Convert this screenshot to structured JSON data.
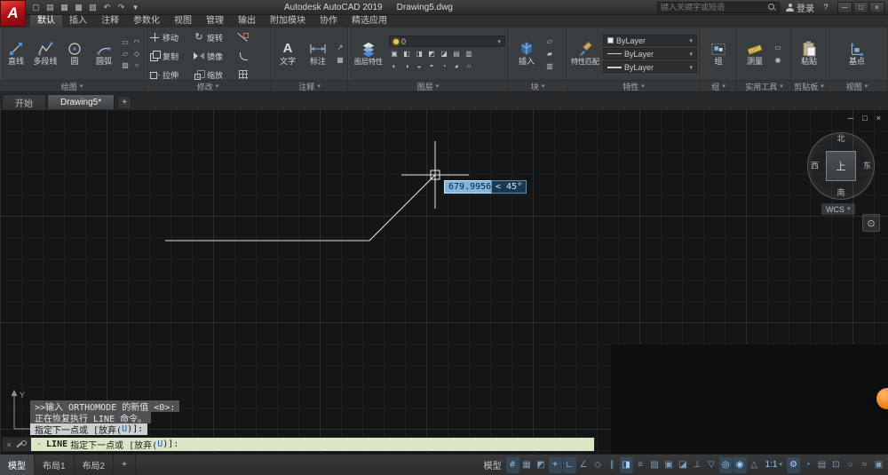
{
  "icons": {
    "chevron_down": "▾",
    "close": "×",
    "minimize": "─",
    "maximize": "□",
    "help": "?",
    "rotate": "↻",
    "text_tool": "A",
    "wheel": "⊙",
    "dash": "-"
  },
  "titlebar": {
    "logo_letter": "A",
    "quick_access": [
      {
        "name": "new-file",
        "glyph": "▢"
      },
      {
        "name": "open-file",
        "glyph": "▤"
      },
      {
        "name": "save-file",
        "glyph": "▦"
      },
      {
        "name": "save-as",
        "glyph": "▩"
      },
      {
        "name": "plot",
        "glyph": "▧"
      },
      {
        "name": "undo",
        "glyph": "↶"
      },
      {
        "name": "redo",
        "glyph": "↷"
      },
      {
        "name": "qat-menu",
        "glyph": "▾"
      }
    ],
    "app_title": "Autodesk AutoCAD 2019",
    "doc_title": "Drawing5.dwg",
    "search_placeholder": "键入关键字或短语",
    "sign_in": "登录"
  },
  "ribbon_tabs": [
    {
      "label": "默认",
      "active": true
    },
    {
      "label": "插入"
    },
    {
      "label": "注释"
    },
    {
      "label": "参数化"
    },
    {
      "label": "视图"
    },
    {
      "label": "管理"
    },
    {
      "label": "输出"
    },
    {
      "label": "附加模块"
    },
    {
      "label": "协作"
    },
    {
      "label": "精选应用"
    }
  ],
  "panels": {
    "draw": {
      "label": "绘图",
      "tools": [
        "直线",
        "多段线",
        "圆",
        "圆弧"
      ],
      "minis": [
        "▭",
        "◠",
        "▱",
        "◇",
        "▨",
        "○"
      ]
    },
    "modify": {
      "label": "修改",
      "tools": [
        "移动",
        "旋转",
        "复制",
        "镜像",
        "拉伸",
        "缩放"
      ]
    },
    "annotate": {
      "label": "注释",
      "text": "文字",
      "dim": "标注",
      "minis": [
        "↗",
        "▦"
      ]
    },
    "layers": {
      "label": "图层",
      "properties": "图层特性",
      "current": "0",
      "minis1": [
        "▣",
        "◧",
        "◨",
        "◩",
        "◪",
        "▤",
        "▥"
      ],
      "minis2": [
        "◐",
        "◑",
        "◒",
        "◓",
        "◔",
        "◕",
        "○"
      ]
    },
    "block": {
      "label": "块",
      "insert": "插入",
      "minis": [
        "▱",
        "▰",
        "▥"
      ]
    },
    "props": {
      "label": "特性",
      "match": "特性匹配",
      "color": "ByLayer",
      "linetype": "ByLayer",
      "lineweight": "ByLayer"
    },
    "groups": {
      "label": "组",
      "group": "组"
    },
    "utils": {
      "label": "实用工具",
      "measure": "测量",
      "minis": [
        "▭",
        "◉"
      ]
    },
    "clipboard": {
      "label": "剪贴板",
      "paste": "粘贴"
    },
    "view": {
      "label": "视图",
      "base": "基点"
    }
  },
  "file_tabs": [
    {
      "label": "开始",
      "name": "start"
    },
    {
      "label": "Drawing5*",
      "name": "drawing5",
      "active": true
    },
    {
      "label": "+",
      "name": "new-drawing"
    }
  ],
  "viewcube": {
    "north": "北",
    "south": "南",
    "east": "东",
    "west": "西",
    "top": "上",
    "wcs": "WCS"
  },
  "canvas": {
    "dyn_length": "679.9956",
    "dyn_angle": "< 45°"
  },
  "command": {
    "history": [
      ">>输入 ORTHOMODE 的新值 <0>:",
      "正在恢复执行 LINE 命令。"
    ],
    "h3_pre": "指定下一点或 [放弃(",
    "h3_link": "U",
    "h3_post": ")]:",
    "cmd": "LINE",
    "p_pre": "指定下一点或 [放弃(",
    "p_link": "U",
    "p_post": ")]:"
  },
  "layout_tabs": [
    {
      "label": "模型",
      "name": "model",
      "active": true
    },
    {
      "label": "布局1",
      "name": "layout1"
    },
    {
      "label": "布局2",
      "name": "layout2"
    },
    {
      "label": "+",
      "name": "new-layout"
    }
  ],
  "statusbar": {
    "model_label": "模型",
    "scale_label": "1:1",
    "icons": [
      {
        "name": "grid",
        "glyph": "#",
        "on": true
      },
      {
        "name": "snap",
        "glyph": "▦",
        "on": false
      },
      {
        "name": "infer-constraints",
        "glyph": "◩",
        "on": false
      },
      {
        "name": "dynamic-input",
        "glyph": "+",
        "on": true
      },
      {
        "name": "ortho",
        "glyph": "∟",
        "on": true
      },
      {
        "name": "polar-tracking",
        "glyph": "∠",
        "on": false
      },
      {
        "name": "isodraft",
        "glyph": "◇",
        "on": false
      },
      {
        "name": "osnap-tracking",
        "glyph": "∥",
        "on": false
      },
      {
        "name": "osnap",
        "glyph": "◨",
        "on": true
      },
      {
        "name": "lineweight",
        "glyph": "≡",
        "on": false
      },
      {
        "name": "transparency",
        "glyph": "▨",
        "on": false
      },
      {
        "name": "selection-cycling",
        "glyph": "▣",
        "on": false
      },
      {
        "name": "3d-osnap",
        "glyph": "◪",
        "on": false
      },
      {
        "name": "dynamic-ucs",
        "glyph": "⊥",
        "on": false
      },
      {
        "name": "selection-filter",
        "glyph": "▽",
        "on": false
      },
      {
        "name": "gizmo",
        "glyph": "◎",
        "on": true
      },
      {
        "name": "annotation-visibility",
        "glyph": "◉",
        "on": true
      },
      {
        "name": "autoscale",
        "glyph": "△",
        "on": false
      }
    ],
    "icons2": [
      {
        "name": "workspace",
        "glyph": "⚙",
        "on": true
      },
      {
        "name": "annotation-monitor",
        "glyph": "◔",
        "on": false
      },
      {
        "name": "quick-properties",
        "glyph": "▤",
        "on": false
      },
      {
        "name": "lock-ui",
        "glyph": "⊡",
        "on": false
      },
      {
        "name": "isolate-objects",
        "glyph": "○",
        "on": false
      },
      {
        "name": "graphics-performance",
        "glyph": "≈",
        "on": false
      },
      {
        "name": "clean-screen",
        "glyph": "▣",
        "on": false
      }
    ]
  },
  "colors": {
    "accent_blue": "#4d8edc",
    "dyn_highlight": "#7db5e0",
    "command_bg": "#d8e6c6",
    "badge_orange": "#ef7d1a"
  }
}
